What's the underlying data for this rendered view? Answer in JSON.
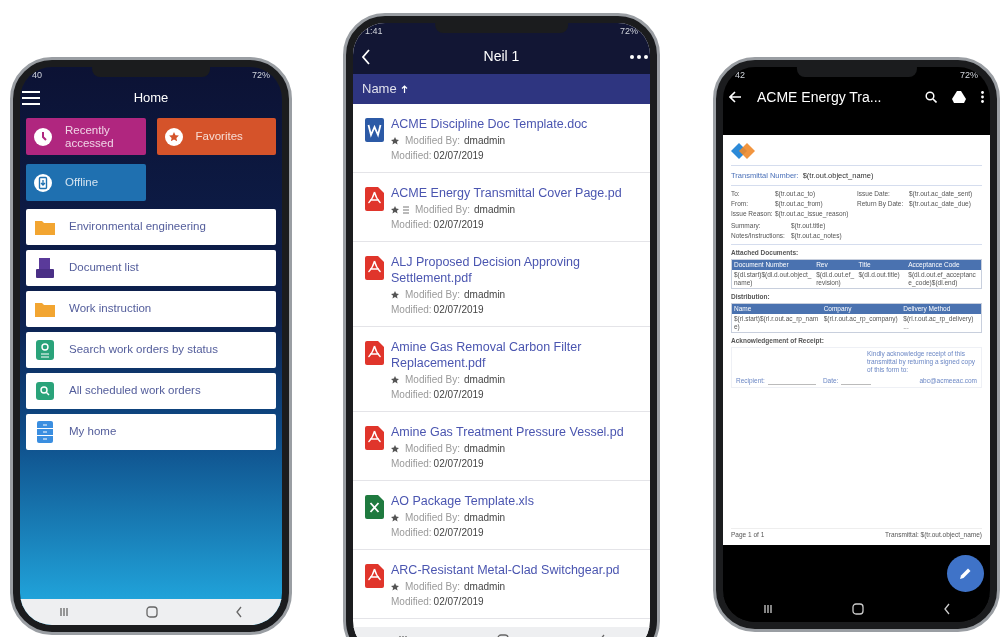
{
  "home_phone": {
    "status_time": "40",
    "battery": "72%",
    "title": "Home",
    "tiles": [
      {
        "label": "Recently accessed",
        "kind": "clock",
        "color": "#b0267f"
      },
      {
        "label": "Favorites",
        "kind": "star",
        "color": "#d5532a"
      },
      {
        "label": "Offline",
        "kind": "offline",
        "color": "#1f70b0"
      }
    ],
    "items": [
      {
        "label": "Environmental engineering",
        "kind": "folder"
      },
      {
        "label": "Document list",
        "kind": "tray"
      },
      {
        "label": "Work instruction",
        "kind": "folder"
      },
      {
        "label": "Search work orders by status",
        "kind": "searchlist"
      },
      {
        "label": "All scheduled work orders",
        "kind": "search"
      },
      {
        "label": "My home",
        "kind": "cabinet"
      }
    ]
  },
  "list_phone": {
    "status_time": "1:41",
    "battery": "72%",
    "title": "Neil 1",
    "sort": {
      "label": "Name"
    },
    "files": [
      {
        "name": "ACME Discipline Doc Template.doc",
        "kind": "word",
        "extra_icon": false,
        "modified_by_label": "Modified By:",
        "modified_by": "dmadmin",
        "modified_label": "Modified:",
        "modified": "02/07/2019"
      },
      {
        "name": "ACME Energy Transmittal Cover Page.pd",
        "kind": "pdf",
        "extra_icon": true,
        "modified_by_label": "Modified By:",
        "modified_by": "dmadmin",
        "modified_label": "Modified:",
        "modified": "02/07/2019"
      },
      {
        "name": "ALJ Proposed Decision Approving Settlement.pdf",
        "kind": "pdf",
        "extra_icon": false,
        "modified_by_label": "Modified By:",
        "modified_by": "dmadmin",
        "modified_label": "Modified:",
        "modified": "02/07/2019"
      },
      {
        "name": "Amine Gas Removal Carbon Filter Replacement.pdf",
        "kind": "pdf",
        "extra_icon": false,
        "modified_by_label": "Modified By:",
        "modified_by": "dmadmin",
        "modified_label": "Modified:",
        "modified": "02/07/2019"
      },
      {
        "name": "Amine Gas Treatment Pressure Vessel.pd",
        "kind": "pdf",
        "extra_icon": false,
        "modified_by_label": "Modified By:",
        "modified_by": "dmadmin",
        "modified_label": "Modified:",
        "modified": "02/07/2019"
      },
      {
        "name": "AO Package Template.xls",
        "kind": "excel",
        "extra_icon": false,
        "modified_by_label": "Modified By:",
        "modified_by": "dmadmin",
        "modified_label": "Modified:",
        "modified": "02/07/2019"
      },
      {
        "name": "ARC-Resistant Metal-Clad Switchgear.pd",
        "kind": "pdf",
        "extra_icon": false,
        "modified_by_label": "Modified By:",
        "modified_by": "dmadmin",
        "modified_label": "Modified:",
        "modified": "02/07/2019"
      }
    ]
  },
  "viewer_phone": {
    "status_time": "42",
    "battery": "72%",
    "title": "ACME Energy Tra...",
    "document": {
      "transmittal_label": "Transmittal Number:",
      "transmittal_value": "$(tr.out.object_name)",
      "fields_left": [
        {
          "label": "To:",
          "value": "$(tr.out.ac_to)"
        },
        {
          "label": "From:",
          "value": "$(tr.out.ac_from)"
        },
        {
          "label": "Issue Reason:",
          "value": "$(tr.out.ac_issue_reason)"
        }
      ],
      "fields_right": [
        {
          "label": "Issue Date:",
          "value": "$(tr.out.ac_date_sent)"
        },
        {
          "label": "Return By Date:",
          "value": "$(tr.out.ac_date_due)"
        }
      ],
      "fields_more": [
        {
          "label": "Summary:",
          "value": "$(tr.out.title)"
        },
        {
          "label": "Notes/Instructions:",
          "value": "$(tr.out.ac_notes)"
        }
      ],
      "attached": {
        "title": "Attached Documents:",
        "columns": [
          "Document Number",
          "Rev",
          "Title",
          "Acceptance Code"
        ],
        "row": [
          "$(dl.start)$(dl.d.out.object_name)",
          "$(dl.d.out.ef_revision)",
          "$(dl.d.out.title)",
          "$(dl.d.out.ef_acceptance_code)$(dl.end)"
        ]
      },
      "distribution": {
        "title": "Distribution:",
        "columns": [
          "Name",
          "Company",
          "Delivery Method"
        ],
        "row": [
          "$(rl.start)$(rl.r.out.ac_rp_name)",
          "$(rl.r.out.ac_rp_company)",
          "$(rl.r.out.ac_rp_delivery) ..."
        ]
      },
      "ack": {
        "title": "Acknowledgement of Receipt:",
        "note": "Kindly acknowledge receipt of this transmittal by returning a signed copy of this form to:",
        "recipient_label": "Recipient:",
        "date_label": "Date:",
        "email": "abc@acmeeac.com"
      },
      "footer_left": "Page 1 of 1",
      "footer_right": "Transmittal: $(tr.out.object_name)"
    }
  }
}
